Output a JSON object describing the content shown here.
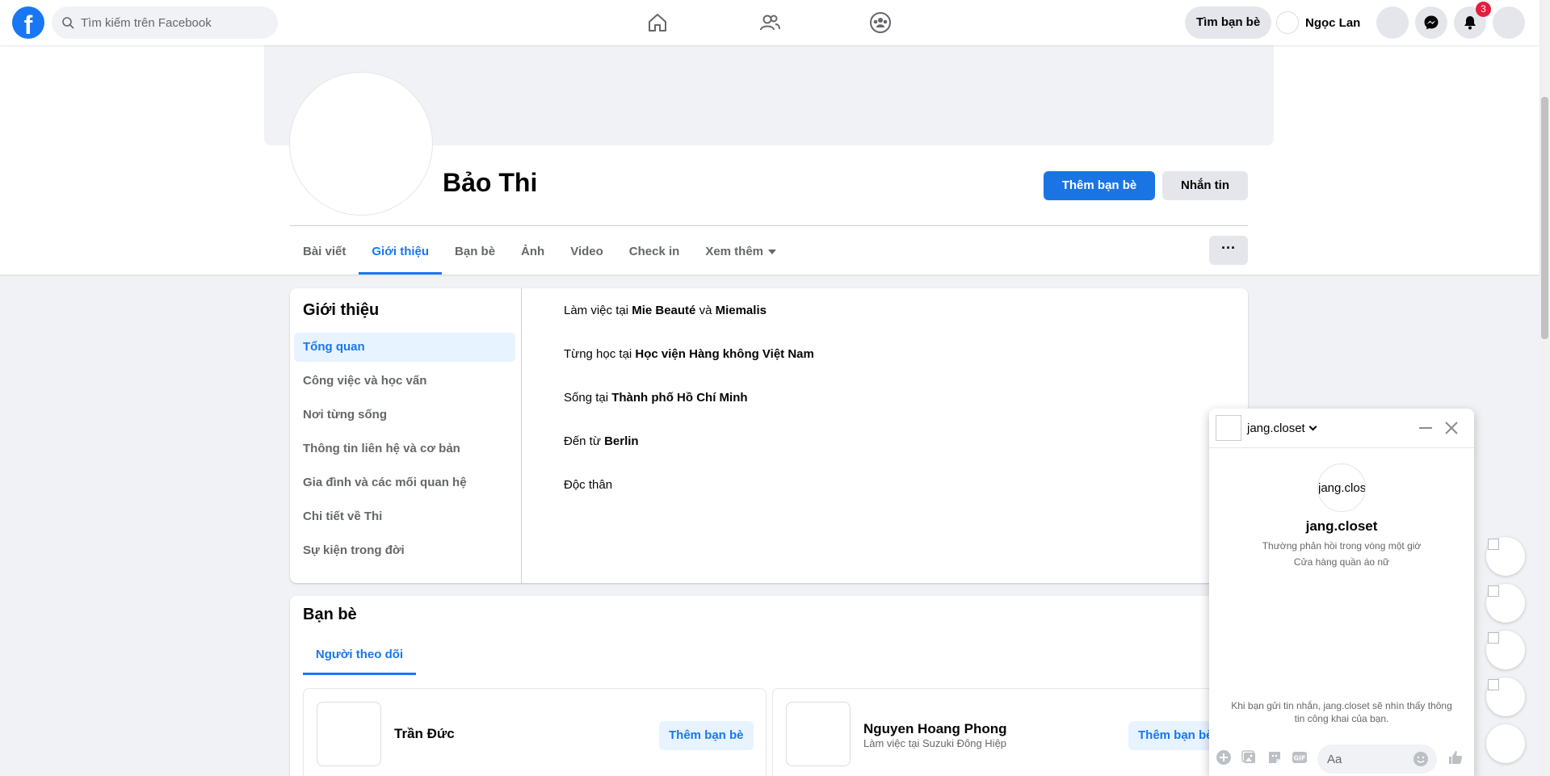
{
  "nav": {
    "search_placeholder": "Tìm kiếm trên Facebook",
    "find_friends": "Tìm bạn bè",
    "user_name": "Ngọc Lan",
    "notification_count": "3"
  },
  "profile": {
    "name": "Bảo Thi",
    "add_friend": "Thêm bạn bè",
    "message": "Nhắn tin",
    "more_dots": "···"
  },
  "tabs": [
    {
      "label": "Bài viết"
    },
    {
      "label": "Giới thiệu"
    },
    {
      "label": "Bạn bè"
    },
    {
      "label": "Ảnh"
    },
    {
      "label": "Video"
    },
    {
      "label": "Check in"
    },
    {
      "label": "Xem thêm"
    }
  ],
  "about": {
    "title": "Giới thiệu",
    "menu": [
      {
        "label": "Tổng quan"
      },
      {
        "label": "Công việc và học vấn"
      },
      {
        "label": "Nơi từng sống"
      },
      {
        "label": "Thông tin liên hệ và cơ bản"
      },
      {
        "label": "Gia đình và các mối quan hệ"
      },
      {
        "label": "Chi tiết về Thi"
      },
      {
        "label": "Sự kiện trong đời"
      }
    ],
    "work_prefix": "Làm việc tại ",
    "work_1": "Mie Beauté",
    "work_and": " và ",
    "work_2": "Miemalis",
    "study_prefix": "Từng học tại ",
    "study": "Học viện Hàng không Việt Nam",
    "live_prefix": "Sống tại ",
    "live": "Thành phố Hồ Chí Minh",
    "from_prefix": "Đến từ ",
    "from": "Berlin",
    "relationship": "Độc thân"
  },
  "friends": {
    "title": "Bạn bè",
    "tab": "Người theo dõi",
    "list": [
      {
        "name": "Trần Đức",
        "sub": "",
        "button": "Thêm bạn bè"
      },
      {
        "name": "Nguyen Hoang Phong",
        "sub": "Làm việc tại Suzuki Đông Hiệp",
        "button": "Thêm bạn bè"
      }
    ]
  },
  "chat": {
    "header_name": "jang.closet",
    "avatar_text": "jang.clos",
    "profile_name": "jang.closet",
    "response_time": "Thường phản hồi trong vòng một giờ",
    "category": "Cửa hàng quần áo nữ",
    "notice": "Khi bạn gửi tin nhắn, jang.closet sẽ nhìn thấy thông tin công khai của bạn.",
    "input_placeholder": "Aa"
  },
  "colors": {
    "brand": "#1877f2",
    "badge": "#e41e3f"
  },
  "icons": [
    "facebook-logo-icon",
    "search-icon",
    "home-icon",
    "friends-icon",
    "groups-icon",
    "messenger-icon",
    "bell-icon",
    "close-icon",
    "plus-circle-icon",
    "image-icon",
    "sticker-icon",
    "gif-icon",
    "emoji-icon",
    "like-icon"
  ]
}
